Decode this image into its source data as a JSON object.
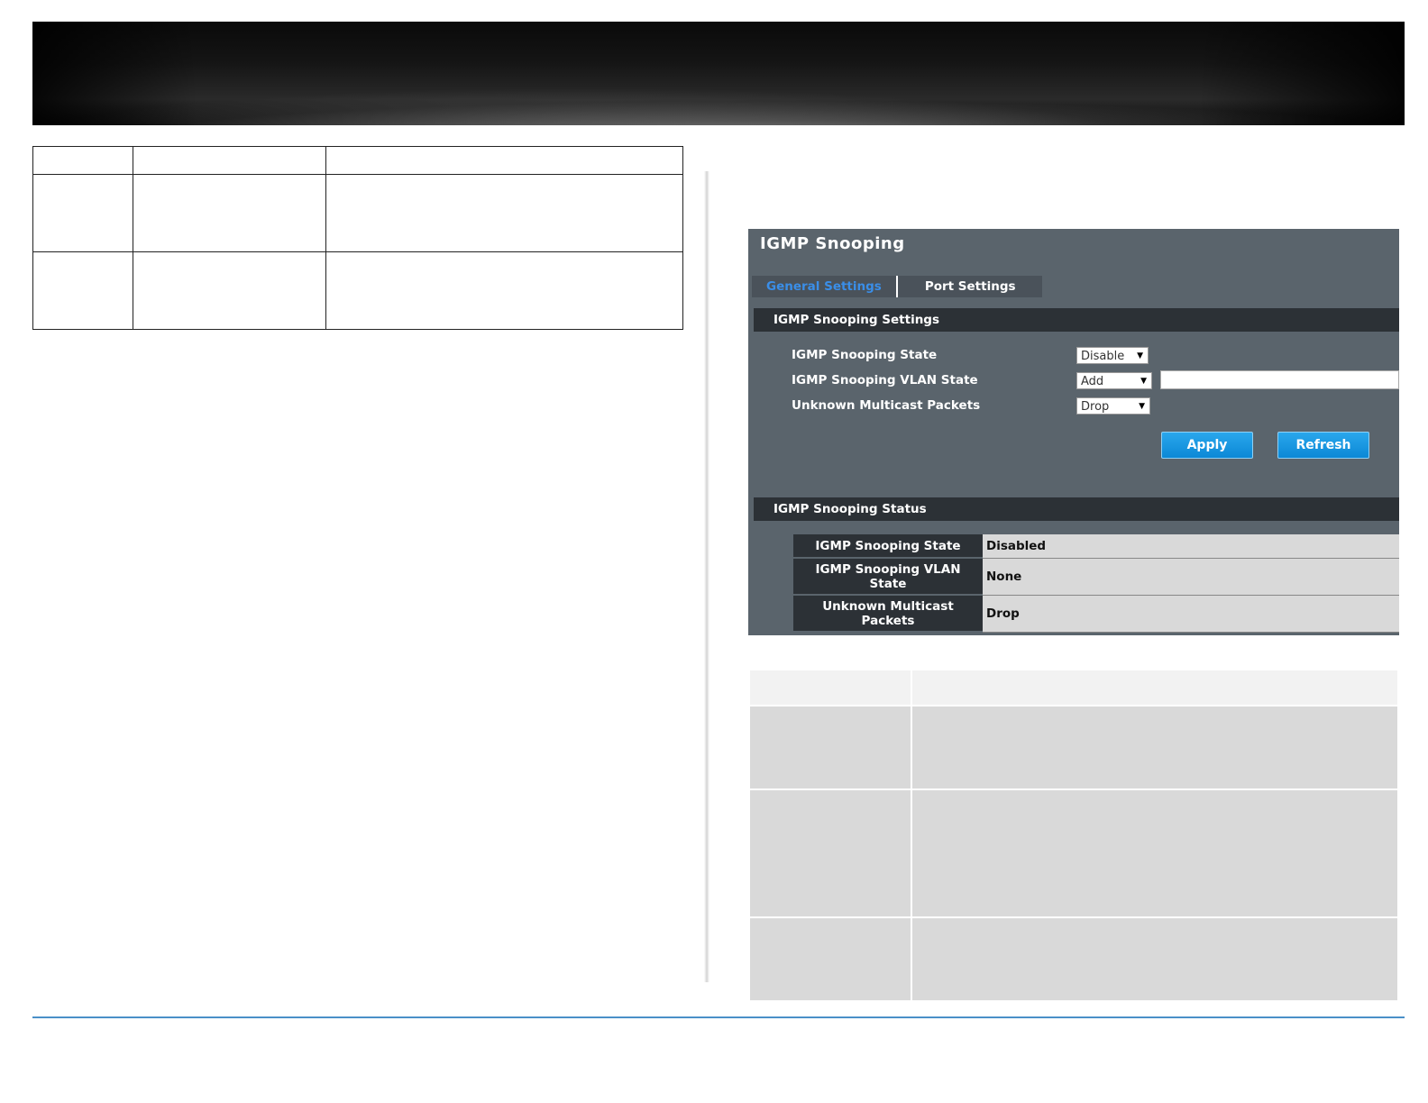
{
  "panel": {
    "title": "IGMP Snooping",
    "tabs": [
      {
        "label": "General Settings",
        "active": true
      },
      {
        "label": "Port Settings",
        "active": false
      }
    ],
    "settings_section": {
      "heading": "IGMP Snooping Settings",
      "fields": [
        {
          "label": "IGMP Snooping State",
          "value": "Disable"
        },
        {
          "label": "IGMP Snooping VLAN State",
          "value": "Add",
          "text_value": ""
        },
        {
          "label": "Unknown Multicast Packets",
          "value": "Drop"
        }
      ],
      "apply_label": "Apply",
      "refresh_label": "Refresh"
    },
    "status_section": {
      "heading": "IGMP Snooping Status",
      "rows": [
        {
          "key": "IGMP Snooping State",
          "value": "Disabled"
        },
        {
          "key": "IGMP Snooping VLAN State",
          "value": "None"
        },
        {
          "key": "Unknown Multicast Packets",
          "value": "Drop"
        }
      ]
    }
  },
  "colors": {
    "panel_bg": "#5a646c",
    "section_bar": "#2c3136",
    "active_tab": "#3a8ee8",
    "button": "#0b88d6",
    "footer_rule": "#4a90c8"
  }
}
